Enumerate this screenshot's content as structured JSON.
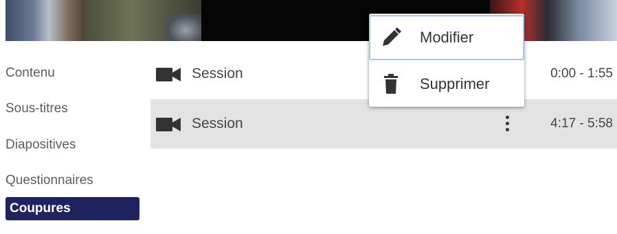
{
  "nav": {
    "items": [
      {
        "label": "Contenu"
      },
      {
        "label": "Sous-titres"
      },
      {
        "label": "Diapositives"
      },
      {
        "label": "Questionnaires"
      },
      {
        "label": "Coupures",
        "active": true
      }
    ]
  },
  "list": {
    "rows": [
      {
        "title": "Session",
        "time": "0:00 - 1:55",
        "icon": "video-camera-icon"
      },
      {
        "title": "Session",
        "time": "4:17 - 5:58",
        "icon": "video-camera-icon"
      }
    ]
  },
  "menu": {
    "edit_label": "Modifier",
    "edit_icon": "pencil-icon",
    "delete_label": "Supprimer",
    "delete_icon": "trash-icon"
  },
  "colors": {
    "active_nav": "#1f2460",
    "selected_row": "#e3e3e3",
    "menu_focus_border": "#a9c6ea"
  }
}
